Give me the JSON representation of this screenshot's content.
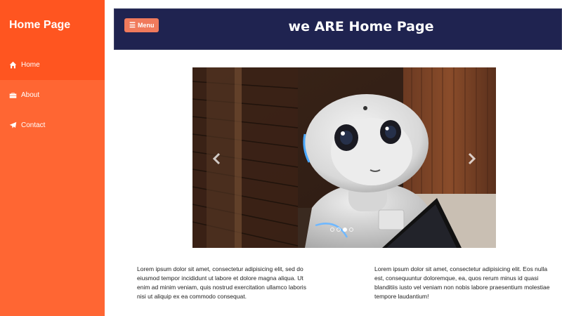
{
  "sidebar": {
    "title": "Home Page",
    "items": [
      {
        "label": "Home",
        "icon": "home-icon",
        "active": true
      },
      {
        "label": "About",
        "icon": "briefcase-icon",
        "active": false
      },
      {
        "label": "Contact",
        "icon": "paper-plane-icon",
        "active": false
      }
    ]
  },
  "header": {
    "menu_label": "Menu",
    "title": "we ARE Home Page"
  },
  "carousel": {
    "slide_count": 4,
    "active_slide": 3
  },
  "content": {
    "left_text": "Lorem ipsum dolor sit amet, consectetur adipisicing elit, sed do eiusmod tempor incididunt ut labore et dolore magna aliqua. Ut enim ad minim veniam, quis nostrud exercitation ullamco laboris nisi ut aliquip ex ea commodo consequat.",
    "right_text": "Lorem ipsum dolor sit amet, consectetur adipisicing elit. Eos nulla est, consequuntur doloremque, ea, quos rerum minus id quasi blanditiis iusto vel veniam non nobis labore praesentium molestiae tempore laudantium!"
  },
  "colors": {
    "sidebar": "#ff6633",
    "sidebar_active": "#ff5520",
    "header": "#1f2350",
    "menu_button": "#f07a5c"
  }
}
